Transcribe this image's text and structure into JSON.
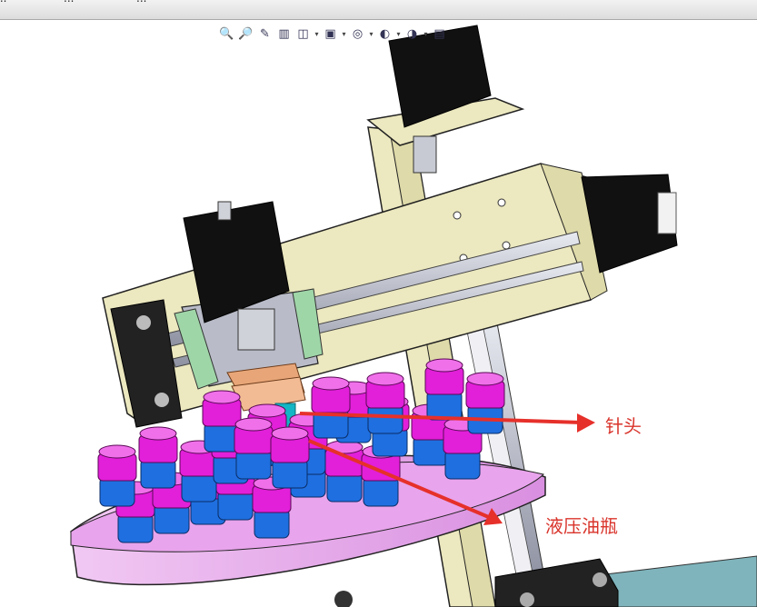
{
  "window": {
    "tabs": [
      "...",
      "...",
      "..."
    ]
  },
  "heads_up_toolbar": {
    "buttons": [
      {
        "icon": "zoom-to-fit-icon"
      },
      {
        "icon": "zoom-to-area-icon"
      },
      {
        "icon": "previous-view-icon"
      },
      {
        "icon": "section-view-icon"
      },
      {
        "icon": "view-orientation-icon",
        "dropdown": true
      },
      {
        "icon": "display-style-icon",
        "dropdown": true
      },
      {
        "icon": "hide-show-items-icon",
        "dropdown": true
      },
      {
        "icon": "edit-appearance-icon",
        "dropdown": true
      },
      {
        "icon": "apply-scene-icon",
        "dropdown": true
      },
      {
        "icon": "view-settings-icon"
      }
    ]
  },
  "annotations": {
    "needle": "针头",
    "hydraulic_oil_bottle": "液压油瓶"
  },
  "colors": {
    "frame": "#ece8bf",
    "motor": "#111111",
    "turntable": "#e8a4ec",
    "bottle_cap": "#e21fd9",
    "bottle_body": "#1f6fe0",
    "needle": "#13b6c4",
    "arrow": "#e6302a",
    "steel": "#b9bcc8"
  }
}
